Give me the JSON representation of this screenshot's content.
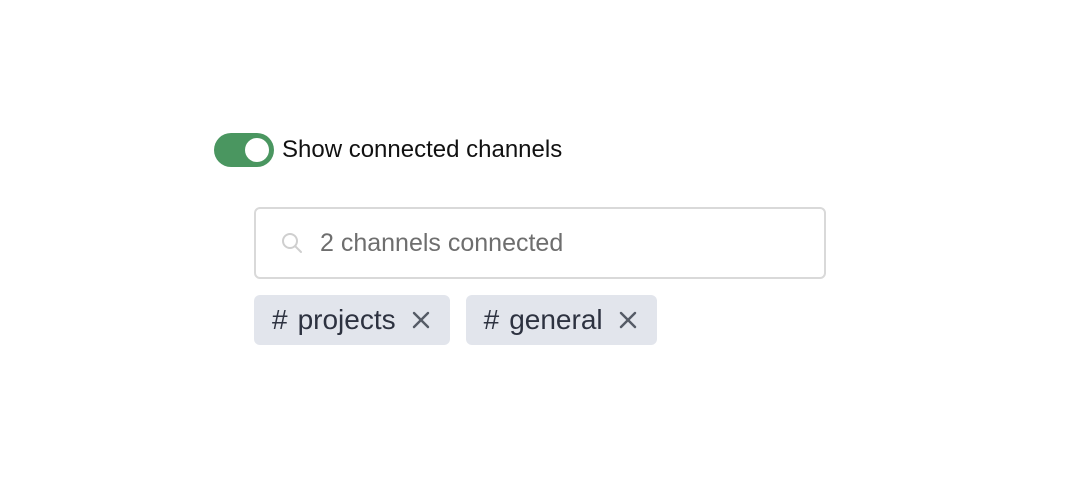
{
  "toggle": {
    "label": "Show connected channels",
    "checked": true,
    "on_color": "#4a9660"
  },
  "search": {
    "placeholder": "2 channels connected",
    "value": "",
    "icon": "search-icon"
  },
  "channels": [
    {
      "hash": "#",
      "name": "projects",
      "remove_icon": "close-icon"
    },
    {
      "hash": "#",
      "name": "general",
      "remove_icon": "close-icon"
    }
  ],
  "colors": {
    "chip_background": "#e2e5ec",
    "chip_text": "#2d3240"
  }
}
